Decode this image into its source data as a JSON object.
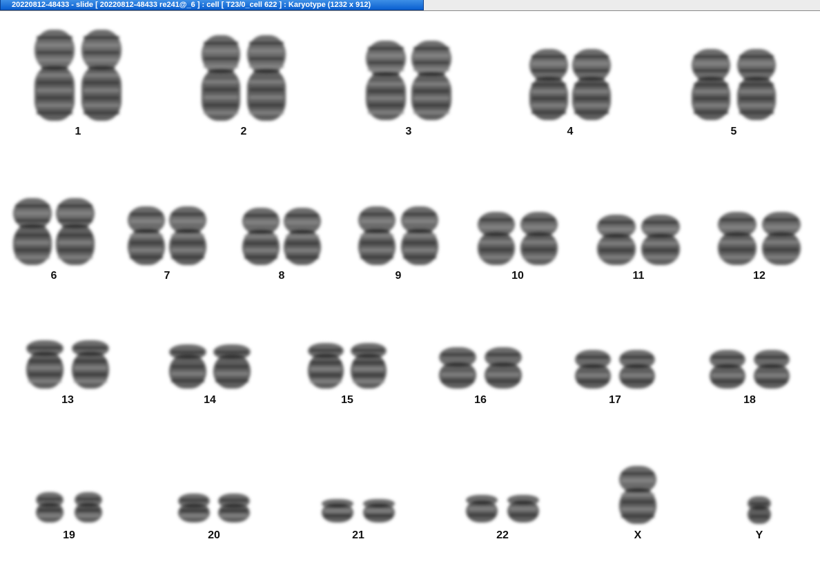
{
  "window": {
    "title": "20220812-48433 - slide [ 20220812-48433 re241@_6 ] : cell [ T23/0_cell 622 ] : Karyotype  (1232 x 912)"
  },
  "karyotype": {
    "chromosomes": [
      {
        "label": "1"
      },
      {
        "label": "2"
      },
      {
        "label": "3"
      },
      {
        "label": "4"
      },
      {
        "label": "5"
      },
      {
        "label": "6"
      },
      {
        "label": "7"
      },
      {
        "label": "8"
      },
      {
        "label": "9"
      },
      {
        "label": "10"
      },
      {
        "label": "11"
      },
      {
        "label": "12"
      },
      {
        "label": "13"
      },
      {
        "label": "14"
      },
      {
        "label": "15"
      },
      {
        "label": "16"
      },
      {
        "label": "17"
      },
      {
        "label": "18"
      },
      {
        "label": "19"
      },
      {
        "label": "20"
      },
      {
        "label": "21"
      },
      {
        "label": "22"
      },
      {
        "label": "X"
      },
      {
        "label": "Y"
      }
    ]
  }
}
